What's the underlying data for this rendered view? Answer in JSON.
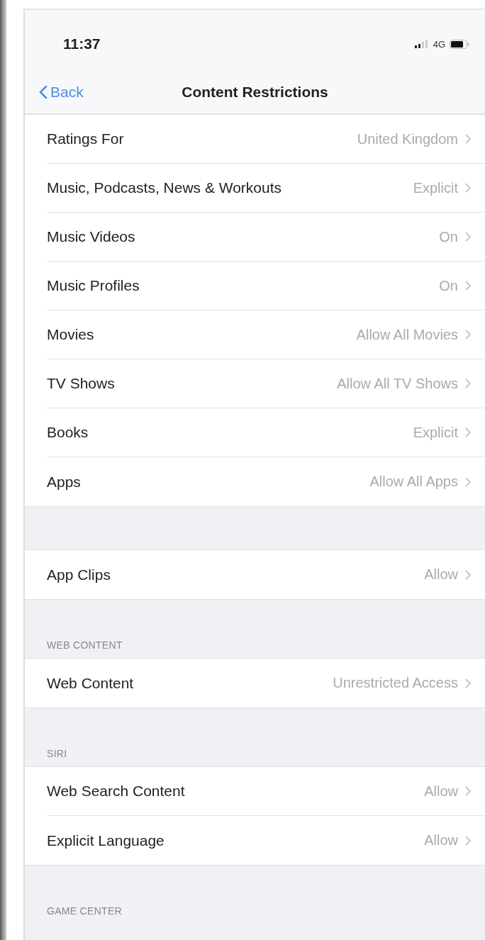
{
  "status_bar": {
    "time": "11:37",
    "network": "4G"
  },
  "nav": {
    "back": "Back",
    "title": "Content Restrictions"
  },
  "sections": [
    {
      "rows": [
        {
          "label": "Ratings For",
          "value": "United Kingdom"
        },
        {
          "label": "Music, Podcasts, News & Workouts",
          "value": "Explicit"
        },
        {
          "label": "Music Videos",
          "value": "On"
        },
        {
          "label": "Music Profiles",
          "value": "On"
        },
        {
          "label": "Movies",
          "value": "Allow All Movies"
        },
        {
          "label": "TV Shows",
          "value": "Allow All TV Shows"
        },
        {
          "label": "Books",
          "value": "Explicit"
        },
        {
          "label": "Apps",
          "value": "Allow All Apps"
        }
      ]
    },
    {
      "rows": [
        {
          "label": "App Clips",
          "value": "Allow"
        }
      ]
    },
    {
      "header": "WEB CONTENT",
      "rows": [
        {
          "label": "Web Content",
          "value": "Unrestricted Access"
        }
      ]
    },
    {
      "header": "SIRI",
      "rows": [
        {
          "label": "Web Search Content",
          "value": "Allow"
        },
        {
          "label": "Explicit Language",
          "value": "Allow"
        }
      ]
    },
    {
      "header": "GAME CENTER"
    }
  ]
}
